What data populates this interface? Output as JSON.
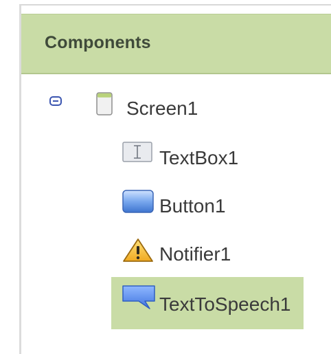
{
  "panel": {
    "title": "Components"
  },
  "tree": {
    "root": {
      "label": "Screen1",
      "icon": "screen-icon",
      "expanded": true
    },
    "children": [
      {
        "label": "TextBox1",
        "icon": "textbox-icon",
        "selected": false
      },
      {
        "label": "Button1",
        "icon": "button-icon",
        "selected": false
      },
      {
        "label": "Notifier1",
        "icon": "warning-triangle-icon",
        "selected": false
      },
      {
        "label": "TextToSpeech1",
        "icon": "speech-bubble-icon",
        "selected": true
      }
    ]
  },
  "colors": {
    "header_bg": "#c9dca6",
    "selection_bg": "#c9dca6",
    "toggle": "#3b55b0"
  }
}
